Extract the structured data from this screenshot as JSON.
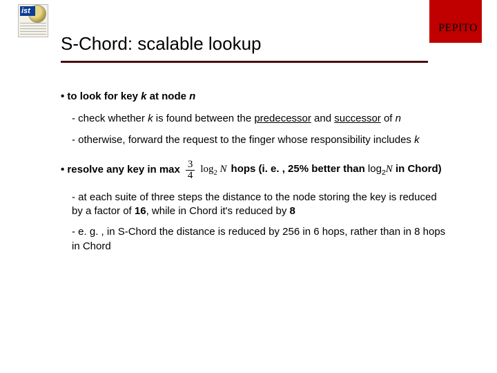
{
  "header": {
    "label": "PEPITO",
    "logo_text": "ist"
  },
  "title": "S-Chord: scalable lookup",
  "b1": {
    "prefix": "• to look for key ",
    "k": "k",
    "mid": " at node ",
    "n": "n"
  },
  "b1a": {
    "t1": "check whether ",
    "k": "k",
    "t2": " is found between the ",
    "pred": "predecessor",
    "t3": " and ",
    "succ": "successor",
    "t4": " of ",
    "n": "n"
  },
  "b1b": {
    "t1": "otherwise, forward the request to the finger whose responsibility includes ",
    "k": "k"
  },
  "b2": {
    "t1": "• resolve any key in max",
    "frac_num": "3",
    "frac_den": "4",
    "log": "log",
    "two": "2",
    "N": "N",
    "t2": "hops (i. e. , 25% better than ",
    "log2_txt": "log",
    "two2": "2",
    "N2": "N",
    "t3": " in Chord)"
  },
  "b2a": {
    "t1": "at each suite of three steps the distance to the node storing the key is reduced by a factor of ",
    "f16": "16",
    "t2": ", while in Chord it's reduced by ",
    "f8": "8"
  },
  "b2b": {
    "t1": "e. g. , in S-Chord the distance is reduced by 256 in 6 hops, rather than in 8 hops in Chord"
  }
}
